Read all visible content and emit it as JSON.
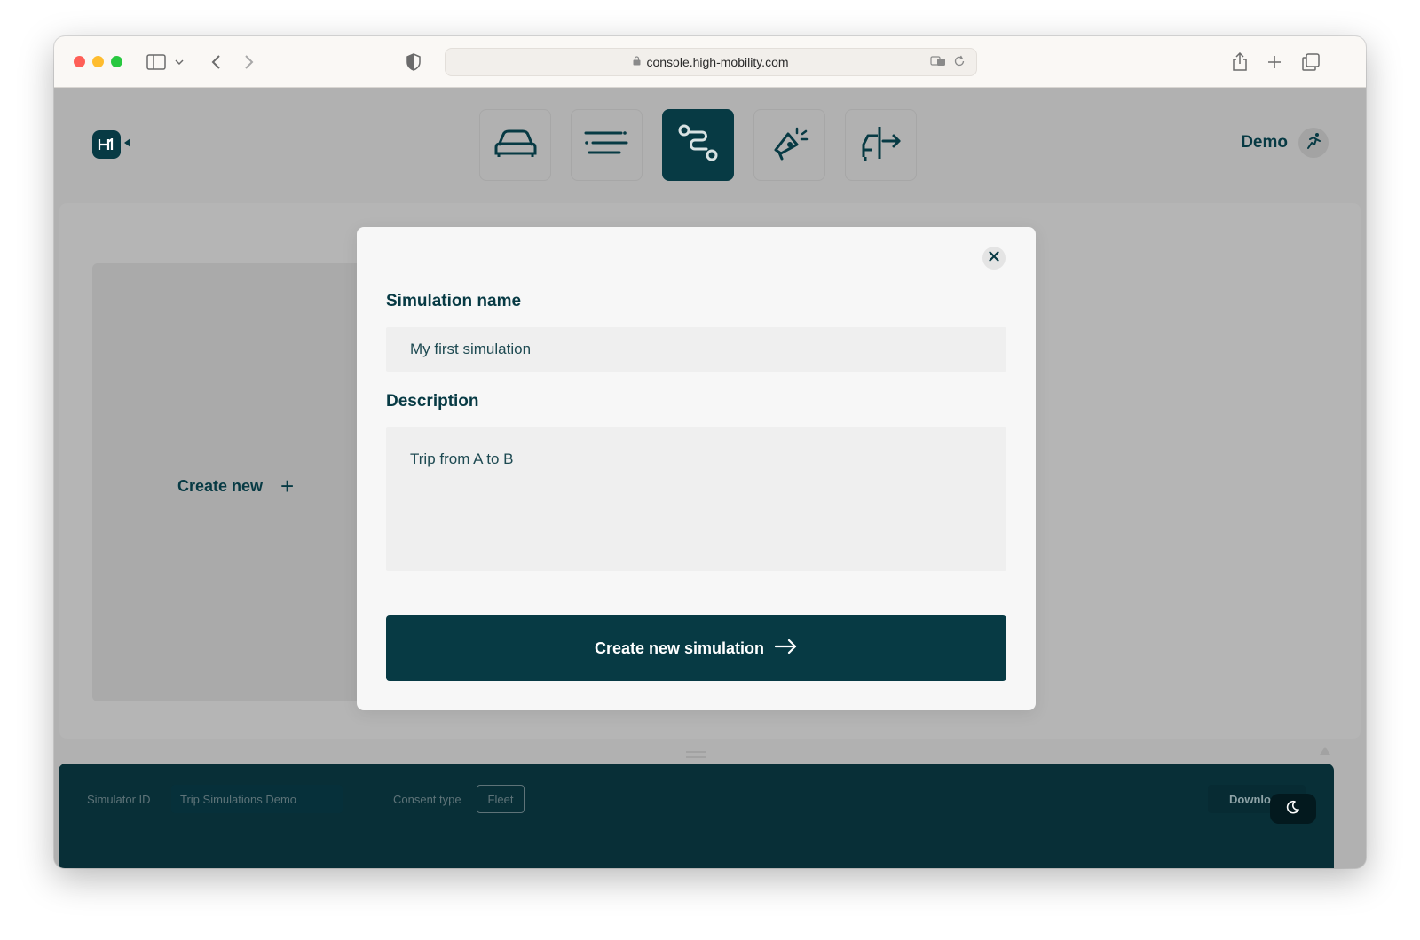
{
  "browser": {
    "url": "console.high-mobility.com"
  },
  "app": {
    "logo_text": "H",
    "nav": [
      {
        "icon": "car-icon",
        "active": false
      },
      {
        "icon": "filter-lines-icon",
        "active": false
      },
      {
        "icon": "route-icon",
        "active": true
      },
      {
        "icon": "megaphone-icon",
        "active": false
      },
      {
        "icon": "car-share-icon",
        "active": false
      }
    ],
    "user": {
      "name": "Demo"
    }
  },
  "main": {
    "create_new_label": "Create new",
    "create_new_icon": "+"
  },
  "modal": {
    "name_label": "Simulation name",
    "name_value": "My first simulation",
    "description_label": "Description",
    "description_value": "Trip from A to B",
    "submit_label": "Create new simulation"
  },
  "bottom_bar": {
    "simulator_id_label": "Simulator ID",
    "simulator_id_value": "Trip Simulations Demo",
    "consent_type_label": "Consent type",
    "consent_type_value": "Fleet",
    "download_label": "Downlo"
  },
  "colors": {
    "primary": "#073a44",
    "overlay": "#b1b1b1",
    "modal_bg": "#f7f7f7",
    "bottom_bar": "#082f37"
  }
}
